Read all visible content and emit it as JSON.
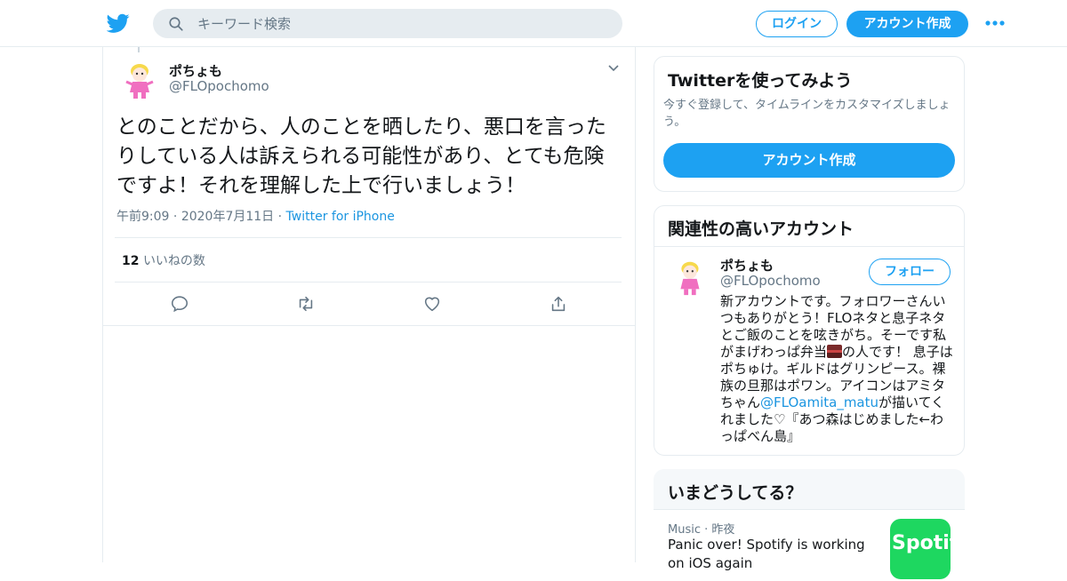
{
  "header": {
    "search_placeholder": "キーワード検索",
    "login_label": "ログイン",
    "signup_label": "アカウント作成",
    "brand_color": "#1da1f2"
  },
  "tweet": {
    "author_name": "ポちょも",
    "author_handle": "@FLOpochomo",
    "text": "とのことだから、人のことを晒したり、悪口を言ったりしている人は訴えられる可能性があり、とても危険ですよ！それを理解した上で行いましょう！",
    "time": "午前9:09",
    "date": "2020年7月11日",
    "source": "Twitter for iPhone",
    "likes_count": "12",
    "likes_label": "いいねの数"
  },
  "sidebar": {
    "try_card": {
      "title": "Twitterを使ってみよう",
      "description": "今すぐ登録して、タイムラインをカスタマイズしましょう。",
      "cta_label": "アカウント作成"
    },
    "related": {
      "title": "関連性の高いアカウント",
      "name": "ポちょも",
      "handle": "@FLOpochomo",
      "follow_label": "フォロー",
      "bio_part1": "新アカウントです。フォロワーさんいつもありがとう！FLOネタと息子ネタとご飯のことを呟きがち。そーです私がまげわっぱ弁当",
      "bio_part2": "の人です！ 息子はポちゅけ。ギルドはグリンピース。裸族の旦那はポワン。アイコンはアミタちゃん",
      "bio_mention": "@FLOamita_matu",
      "bio_part3": "が描いてくれました♡『あつ森はじめました←わっぱべん島』"
    },
    "trends": {
      "title": "いまどうしてる？",
      "category": "Music",
      "time": "昨夜",
      "headline": "Panic over! Spotify is working on iOS again",
      "thumb_text": "Spotify"
    }
  }
}
